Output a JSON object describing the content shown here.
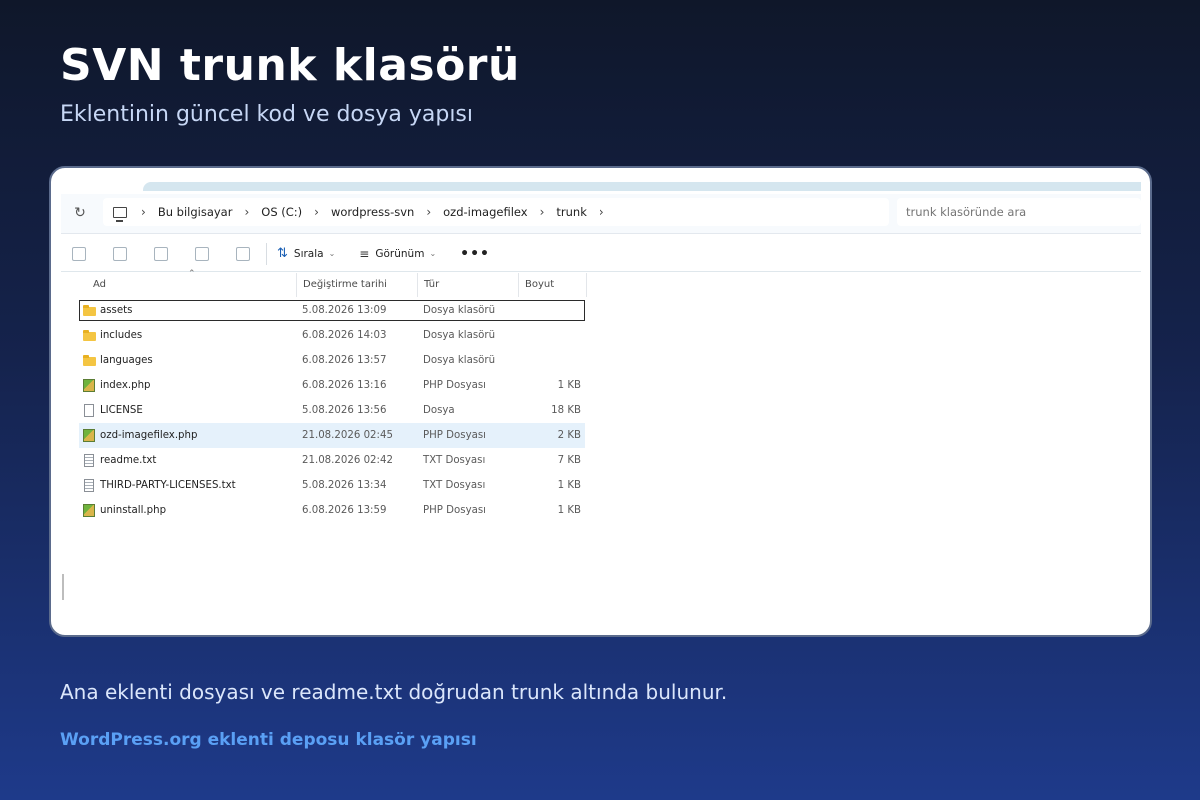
{
  "page": {
    "title": "SVN trunk klasörü",
    "subtitle": "Eklentinin güncel kod ve dosya yapısı",
    "caption": "Ana eklenti dosyası ve readme.txt doğrudan trunk altında bulunur.",
    "link_text": "WordPress.org eklenti deposu klasör yapısı"
  },
  "explorer": {
    "breadcrumb": [
      "Bu bilgisayar",
      "OS (C:)",
      "wordpress-svn",
      "ozd-imagefilex",
      "trunk"
    ],
    "search_placeholder": "trunk klasöründe ara",
    "toolbar": {
      "sort_label": "Sırala",
      "view_label": "Görünüm",
      "more_label": "•••"
    },
    "columns": {
      "name": "Ad",
      "modified": "Değiştirme tarihi",
      "type": "Tür",
      "size": "Boyut"
    },
    "files": [
      {
        "name": "assets",
        "modified": "5.08.2026 13:09",
        "type": "Dosya klasörü",
        "size": "",
        "icon": "folder-icon"
      },
      {
        "name": "includes",
        "modified": "6.08.2026 14:03",
        "type": "Dosya klasörü",
        "size": "",
        "icon": "folder-icon"
      },
      {
        "name": "languages",
        "modified": "6.08.2026 13:57",
        "type": "Dosya klasörü",
        "size": "",
        "icon": "folder-icon"
      },
      {
        "name": "index.php",
        "modified": "6.08.2026 13:16",
        "type": "PHP Dosyası",
        "size": "1 KB",
        "icon": "php-file-icon"
      },
      {
        "name": "LICENSE",
        "modified": "5.08.2026 13:56",
        "type": "Dosya",
        "size": "18 KB",
        "icon": "file-icon"
      },
      {
        "name": "ozd-imagefilex.php",
        "modified": "21.08.2026 02:45",
        "type": "PHP Dosyası",
        "size": "2 KB",
        "icon": "php-file-icon"
      },
      {
        "name": "readme.txt",
        "modified": "21.08.2026 02:42",
        "type": "TXT Dosyası",
        "size": "7 KB",
        "icon": "text-file-icon"
      },
      {
        "name": "THIRD-PARTY-LICENSES.txt",
        "modified": "5.08.2026 13:34",
        "type": "TXT Dosyası",
        "size": "1 KB",
        "icon": "text-file-icon"
      },
      {
        "name": "uninstall.php",
        "modified": "6.08.2026 13:59",
        "type": "PHP Dosyası",
        "size": "1 KB",
        "icon": "php-file-icon"
      }
    ]
  },
  "colors": {
    "accent_link": "#5aa0f5",
    "selection": "#e5f1fb",
    "folder": "#f4c542"
  }
}
